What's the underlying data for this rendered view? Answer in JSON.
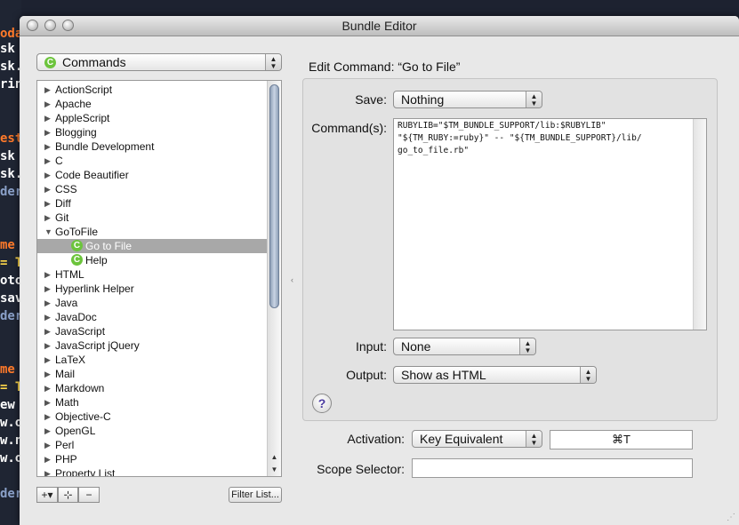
{
  "window": {
    "title": "Bundle Editor"
  },
  "bg_code": [
    {
      "text": "oda",
      "color": "#ff7a2a"
    },
    {
      "text": "sk ",
      "color": "#ffffff"
    },
    {
      "text": "sk.r",
      "color": "#ffffff"
    },
    {
      "text": "rint",
      "color": "#ffffff"
    },
    {
      "text": "est",
      "color": "#ff7a2a"
    },
    {
      "text": "sk ",
      "color": "#ffffff"
    },
    {
      "text": "sk.c",
      "color": "#ffffff"
    },
    {
      "text": "der",
      "color": "#8aa0c8"
    },
    {
      "text": "me",
      "color": "#ff7a2a"
    },
    {
      "text": "= T",
      "color": "#ffd84a"
    },
    {
      "text": "oto",
      "color": "#ffffff"
    },
    {
      "text": "save",
      "color": "#ffffff"
    },
    {
      "text": "der",
      "color": "#8aa0c8"
    },
    {
      "text": "me",
      "color": "#ff7a2a"
    },
    {
      "text": "= T",
      "color": "#ffd84a"
    },
    {
      "text": "ew ",
      "color": "#ffffff"
    },
    {
      "text": "w.ot",
      "color": "#ffffff"
    },
    {
      "text": "w.no",
      "color": "#ffffff"
    },
    {
      "text": "w.ot",
      "color": "#ffffff"
    },
    {
      "text": "der",
      "color": "#8aa0c8"
    }
  ],
  "left_panel": {
    "bundle_selector": {
      "icon": "command-icon",
      "icon_glyph": "C",
      "value": "Commands"
    },
    "tree": [
      {
        "label": "ActionScript",
        "expanded": false
      },
      {
        "label": "Apache",
        "expanded": false
      },
      {
        "label": "AppleScript",
        "expanded": false
      },
      {
        "label": "Blogging",
        "expanded": false
      },
      {
        "label": "Bundle Development",
        "expanded": false
      },
      {
        "label": "C",
        "expanded": false
      },
      {
        "label": "Code Beautifier",
        "expanded": false
      },
      {
        "label": "CSS",
        "expanded": false
      },
      {
        "label": "Diff",
        "expanded": false
      },
      {
        "label": "Git",
        "expanded": false
      },
      {
        "label": "GoToFile",
        "expanded": true
      },
      {
        "label": "Go to File",
        "child": true,
        "selected": true
      },
      {
        "label": "Help",
        "child": true
      },
      {
        "label": "HTML",
        "expanded": false
      },
      {
        "label": "Hyperlink Helper",
        "expanded": false
      },
      {
        "label": "Java",
        "expanded": false
      },
      {
        "label": "JavaDoc",
        "expanded": false
      },
      {
        "label": "JavaScript",
        "expanded": false
      },
      {
        "label": "JavaScript jQuery",
        "expanded": false
      },
      {
        "label": "LaTeX",
        "expanded": false
      },
      {
        "label": "Mail",
        "expanded": false
      },
      {
        "label": "Markdown",
        "expanded": false
      },
      {
        "label": "Math",
        "expanded": false
      },
      {
        "label": "Objective-C",
        "expanded": false
      },
      {
        "label": "OpenGL",
        "expanded": false
      },
      {
        "label": "Perl",
        "expanded": false
      },
      {
        "label": "PHP",
        "expanded": false
      },
      {
        "label": "Property List",
        "expanded": false
      }
    ],
    "buttons": {
      "add": "+▾",
      "add_group": "⊹",
      "remove": "−",
      "filter": "Filter List..."
    }
  },
  "editor": {
    "heading": "Edit Command: “Go to File”",
    "save_label": "Save:",
    "save_value": "Nothing",
    "commands_label": "Command(s):",
    "commands_text": "RUBYLIB=\"$TM_BUNDLE_SUPPORT/lib:$RUBYLIB\"\n\"${TM_RUBY:=ruby}\" -- \"${TM_BUNDLE_SUPPORT}/lib/\ngo_to_file.rb\"",
    "input_label": "Input:",
    "input_value": "None",
    "output_label": "Output:",
    "output_value": "Show as HTML",
    "help_glyph": "?",
    "activation_label": "Activation:",
    "activation_value": "Key Equivalent",
    "key_equivalent": "⌘T",
    "scope_label": "Scope Selector:",
    "scope_value": ""
  }
}
